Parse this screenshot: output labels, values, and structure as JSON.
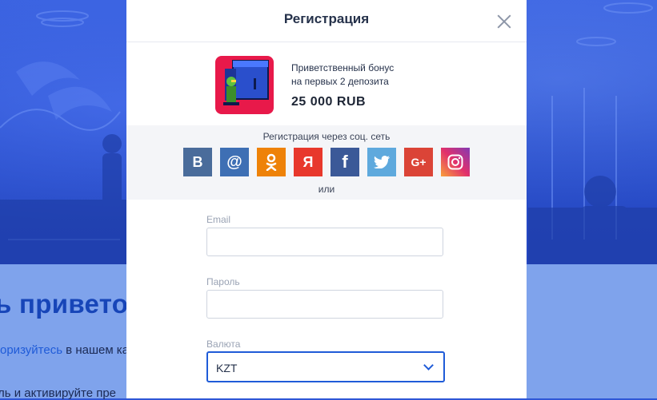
{
  "modal": {
    "title": "Регистрация",
    "bonus": {
      "subtitle_line1": "Приветственный бонус",
      "subtitle_line2": "на первых 2 депозита",
      "amount": "25 000 RUB"
    },
    "social": {
      "label": "Регистрация через соц. сеть",
      "or": "или",
      "buttons": [
        {
          "name": "vk",
          "glyph": "B",
          "color": "#4a6c9b"
        },
        {
          "name": "mail",
          "glyph": "@",
          "color": "#3e6fb4"
        },
        {
          "name": "odnoklassniki",
          "glyph": "ok",
          "color": "#ee8208"
        },
        {
          "name": "yandex",
          "glyph": "Я",
          "color": "#e8382c"
        },
        {
          "name": "facebook",
          "glyph": "f",
          "color": "#3b5998"
        },
        {
          "name": "twitter",
          "glyph": "twitter",
          "color": "#5ea9dd"
        },
        {
          "name": "google-plus",
          "glyph": "G+",
          "color": "#db4437"
        },
        {
          "name": "instagram",
          "glyph": "instagram",
          "color": "#c13584"
        }
      ]
    },
    "form": {
      "email_label": "Email",
      "email_value": "",
      "password_label": "Пароль",
      "password_value": "",
      "currency_label": "Валюта",
      "currency_value": "KZT"
    }
  },
  "background": {
    "heading": "ь привето",
    "line1_link": "оризуйтесь",
    "line1_rest": " в нашем ка",
    "line2": "ль и активируйте пре"
  }
}
